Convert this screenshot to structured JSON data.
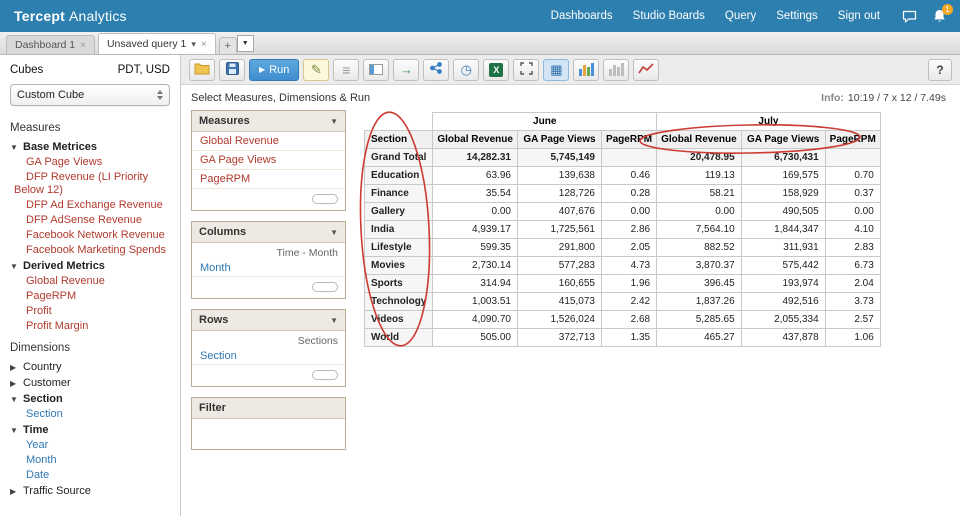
{
  "icons": {
    "close": "×",
    "caret_down": "▾",
    "plus": "+",
    "dropdown_arrow": "▼",
    "play": "▶",
    "tree_open": "▼",
    "tree_closed": "▶",
    "panel_collapse": "▼",
    "pencil": "✎",
    "rows_list": "≡",
    "export_arrow": "→",
    "history_clock": "◷",
    "grid_view": "▦",
    "excel_x": "X"
  },
  "topbar": {
    "brand_primary": "Tercept",
    "brand_secondary": "Analytics",
    "nav_items": [
      "Dashboards",
      "Studio Boards",
      "Query",
      "Settings",
      "Sign out"
    ],
    "notification_count": "1"
  },
  "tabs": {
    "items": [
      {
        "label": "Dashboard 1"
      },
      {
        "label": "Unsaved query 1"
      }
    ]
  },
  "sidebar": {
    "cubes_label": "Cubes",
    "cubes_meta": "PDT, USD",
    "cube_selected": "Custom Cube",
    "measures_label": "Measures",
    "measure_groups": [
      {
        "label": "Base Metrices",
        "expanded": true,
        "items": [
          "GA Page Views",
          "DFP Revenue (LI Priority Below 12)",
          "DFP Ad Exchange Revenue",
          "DFP AdSense Revenue",
          "Facebook Network Revenue",
          "Facebook Marketing Spends"
        ]
      },
      {
        "label": "Derived Metrics",
        "expanded": true,
        "items": [
          "Global Revenue",
          "PageRPM",
          "Profit",
          "Profit Margin"
        ]
      }
    ],
    "dimensions_label": "Dimensions",
    "dimension_groups": [
      {
        "label": "Country",
        "expanded": false,
        "items": []
      },
      {
        "label": "Customer",
        "expanded": false,
        "items": []
      },
      {
        "label": "Section",
        "expanded": true,
        "items": [
          "Section"
        ]
      },
      {
        "label": "Time",
        "expanded": true,
        "items": [
          "Year",
          "Month",
          "Date"
        ]
      },
      {
        "label": "Traffic Source",
        "expanded": false,
        "items": []
      }
    ]
  },
  "toolbar": {
    "run_label": "Run",
    "help_label": "?"
  },
  "workspace": {
    "hint": "Select Measures, Dimensions & Run",
    "info_label": "Info:",
    "info_value": "10:19  /  7 x 12  /  7.49s",
    "panels": {
      "measures": {
        "title": "Measures",
        "items": [
          "Global Revenue",
          "GA Page Views",
          "PageRPM"
        ]
      },
      "columns": {
        "title": "Columns",
        "hint": "Time - Month",
        "item": "Month"
      },
      "rows": {
        "title": "Rows",
        "hint": "Sections",
        "item": "Section"
      },
      "filter": {
        "title": "Filter"
      }
    }
  },
  "table": {
    "corner_label": "Section",
    "column_groups": [
      "June",
      "July"
    ],
    "metrics": [
      "Global Revenue",
      "GA Page Views",
      "PageRPM"
    ],
    "rows": [
      {
        "label": "Grand Total",
        "total": true,
        "cells": [
          "14,282.31",
          "5,745,149",
          "",
          "20,478.95",
          "6,730,431",
          ""
        ]
      },
      {
        "label": "Education",
        "cells": [
          "63.96",
          "139,638",
          "0.46",
          "119.13",
          "169,575",
          "0.70"
        ]
      },
      {
        "label": "Finance",
        "cells": [
          "35.54",
          "128,726",
          "0.28",
          "58.21",
          "158,929",
          "0.37"
        ]
      },
      {
        "label": "Gallery",
        "cells": [
          "0.00",
          "407,676",
          "0.00",
          "0.00",
          "490,505",
          "0.00"
        ]
      },
      {
        "label": "India",
        "cells": [
          "4,939.17",
          "1,725,561",
          "2.86",
          "7,564.10",
          "1,844,347",
          "4.10"
        ]
      },
      {
        "label": "Lifestyle",
        "cells": [
          "599.35",
          "291,800",
          "2.05",
          "882.52",
          "311,931",
          "2.83"
        ]
      },
      {
        "label": "Movies",
        "cells": [
          "2,730.14",
          "577,283",
          "4.73",
          "3,870.37",
          "575,442",
          "6.73"
        ]
      },
      {
        "label": "Sports",
        "cells": [
          "314.94",
          "160,655",
          "1.96",
          "396.45",
          "193,974",
          "2.04"
        ]
      },
      {
        "label": "Technology",
        "cells": [
          "1,003.51",
          "415,073",
          "2.42",
          "1,837.26",
          "492,516",
          "3.73"
        ]
      },
      {
        "label": "Videos",
        "cells": [
          "4,090.70",
          "1,526,024",
          "2.68",
          "5,285.65",
          "2,055,334",
          "2.57"
        ]
      },
      {
        "label": "World",
        "cells": [
          "505.00",
          "372,713",
          "1.35",
          "465.27",
          "437,878",
          "1.06"
        ]
      }
    ]
  },
  "colors": {
    "topbar_blue": "#2c7fae",
    "measure_red": "#b23a2e",
    "link_blue": "#2f78b5",
    "annotation_red": "#cc3b33",
    "badge_orange": "#f5a623"
  }
}
